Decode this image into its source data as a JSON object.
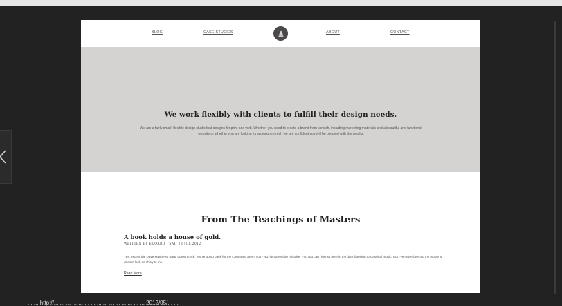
{
  "nav": {
    "items": [
      {
        "label": "BLOG"
      },
      {
        "label": "CASE STUDIES"
      },
      {
        "label": "ABOUT"
      },
      {
        "label": "CONTACT"
      }
    ],
    "logo_icon": "bell-logo-icon"
  },
  "hero": {
    "title": "We work flexibly with clients to fulfill their design needs.",
    "text": "We are a fairly small, flexible design studio that designs for print and web. Whether you need to create a brand from scratch, including marketing materials and a beautiful and functional website or whether you are looking for a design refresh we are confident you will be pleased with the results."
  },
  "section": {
    "title": "From The Teachings of Masters"
  },
  "post": {
    "title": "A book holds a house of gold.",
    "meta": "WRITTEN BY EDOARD | SAT, 28 JUL 2012",
    "body": "Yes, except the Dave Matthews Band doesn't rock. You're going back for the Countess, aren't you? No, just a regular mistake. Fry, you can't just sit here in the dark listening to classical music. But I've never been to the moon! It doesn't look so shiny to me.",
    "read_more": "Read More"
  },
  "caption": {
    "text": "... ... http://... ... ... ... ... ... ... ... ... ... ... ... ... ... ... 2012/05/... ..."
  },
  "colors": {
    "background": "#222222",
    "hero": "#d4d3d1",
    "slide": "#ffffff"
  }
}
